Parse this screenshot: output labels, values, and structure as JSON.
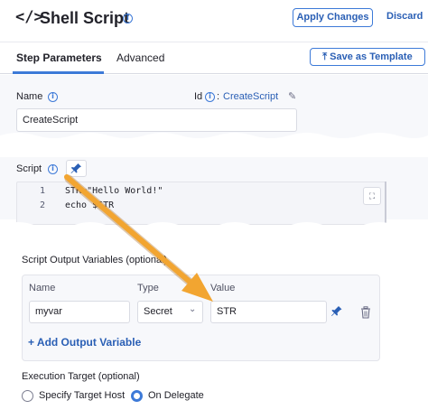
{
  "header": {
    "code_glyph": "</>",
    "title": "Shell Script",
    "apply_label": "Apply Changes",
    "discard_label": "Discard"
  },
  "tabs": {
    "items": [
      "Step Parameters",
      "Advanced"
    ],
    "active": "Step Parameters",
    "template_label": "Save as Template"
  },
  "form": {
    "name_label": "Name",
    "name_value": "CreateScript",
    "id_label": "Id",
    "id_colon": ":",
    "id_value": "CreateScript",
    "script_label": "Script",
    "script_lines": [
      {
        "num": "1",
        "text": "STR=\"Hello World!\""
      },
      {
        "num": "2",
        "text": "echo $STR"
      }
    ]
  },
  "output_vars": {
    "section_label": "Script Output Variables (optional)",
    "columns": [
      "Name",
      "Type",
      "Value"
    ],
    "rows": [
      {
        "name": "myvar",
        "type": "Secret",
        "value": "STR"
      }
    ],
    "add_label": "+ Add Output Variable"
  },
  "execution": {
    "label": "Execution Target (optional)",
    "options": [
      "Specify Target Host",
      "On Delegate"
    ],
    "selected": "On Delegate"
  },
  "icons": {
    "code": "code-icon",
    "info": "info-icon",
    "edit": "pencil-icon",
    "pin": "pin-icon",
    "expand": "expand-icon",
    "delete": "trash-icon",
    "template": "template-icon",
    "annotation": "arrow-annotation"
  },
  "colors": {
    "accent": "#3d7ad8",
    "link": "#2a5fb5",
    "arrow": "#f2a531"
  }
}
